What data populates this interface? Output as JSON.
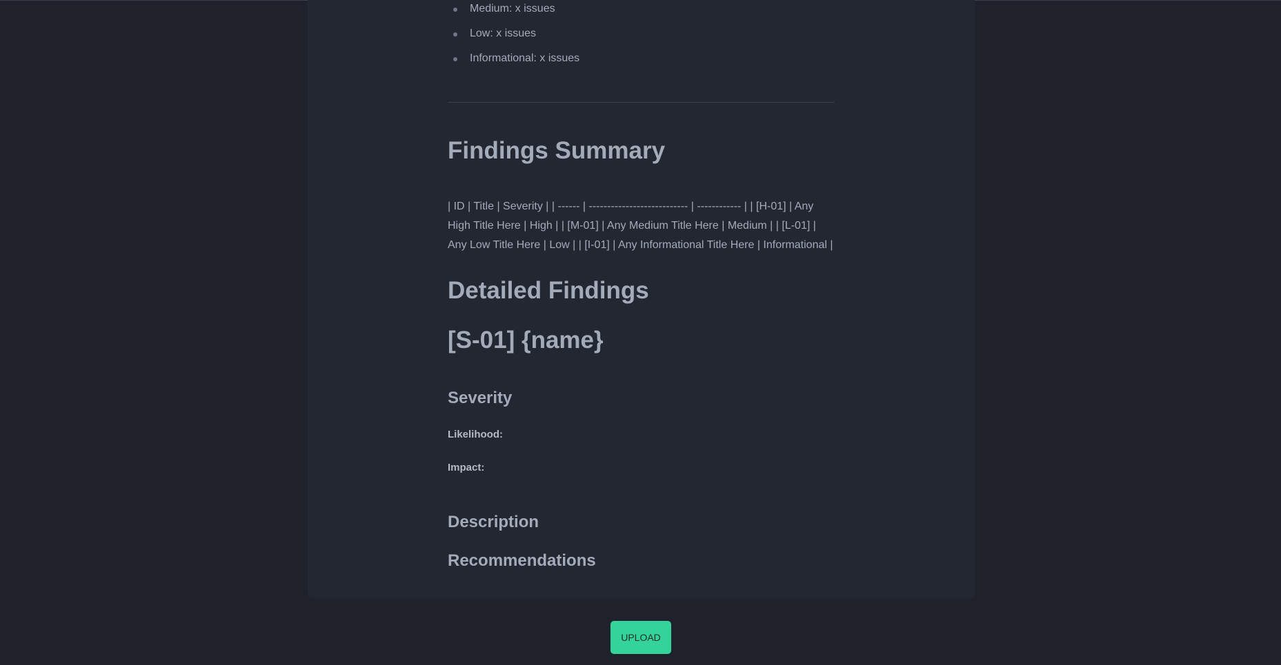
{
  "severity_counts": [
    "Medium: x issues",
    "Low: x issues",
    "Informational: x issues"
  ],
  "findings_summary": {
    "heading": "Findings Summary",
    "table_text": "| ID | Title | Severity | | ------ | --------------------------- | ------------ | | [H-01] | Any High Title Here | High | | [M-01] | Any Medium Title Here | Medium | | [L-01] | Any Low Title Here | Low | | [I-01] | Any Informational Title Here | Informational |"
  },
  "detailed_findings": {
    "heading": "Detailed Findings",
    "finding_title": "[S-01] {name}",
    "severity_heading": "Severity",
    "likelihood_label": "Likelihood:",
    "impact_label": "Impact:",
    "description_heading": "Description",
    "recommendations_heading": "Recommendations"
  },
  "upload_button": {
    "label": "UPLOAD",
    "color": "#34d399"
  }
}
